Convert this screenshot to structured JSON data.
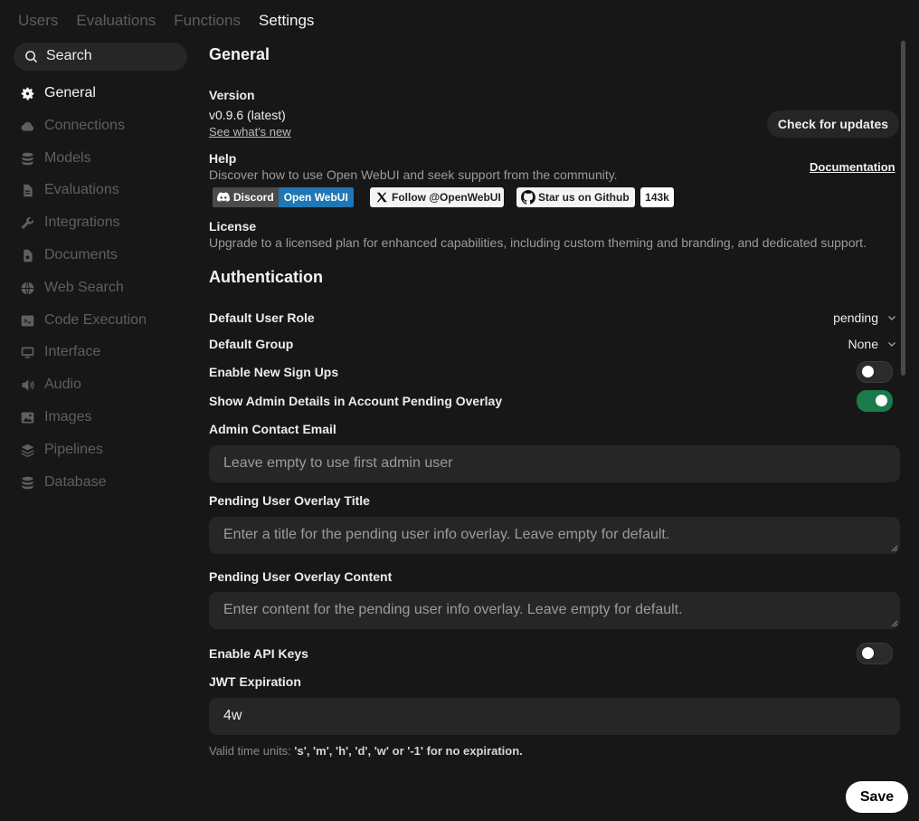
{
  "nav": {
    "tabs": [
      "Users",
      "Evaluations",
      "Functions",
      "Settings"
    ]
  },
  "sidebar": {
    "search_label": "Search",
    "items": [
      {
        "label": "General",
        "icon": "gear-icon"
      },
      {
        "label": "Connections",
        "icon": "cloud-icon"
      },
      {
        "label": "Models",
        "icon": "cube-icon"
      },
      {
        "label": "Evaluations",
        "icon": "document-icon"
      },
      {
        "label": "Integrations",
        "icon": "wrench-icon"
      },
      {
        "label": "Documents",
        "icon": "file-icon"
      },
      {
        "label": "Web Search",
        "icon": "globe-icon"
      },
      {
        "label": "Code Execution",
        "icon": "terminal-icon"
      },
      {
        "label": "Interface",
        "icon": "monitor-icon"
      },
      {
        "label": "Audio",
        "icon": "speaker-icon"
      },
      {
        "label": "Images",
        "icon": "image-icon"
      },
      {
        "label": "Pipelines",
        "icon": "stack-icon"
      },
      {
        "label": "Database",
        "icon": "database-icon"
      }
    ]
  },
  "general": {
    "title": "General",
    "version_label": "Version",
    "version_value": "v0.9.6 (latest)",
    "whats_new": "See what's new",
    "check_updates": "Check for updates",
    "help_label": "Help",
    "help_text": "Discover how to use Open WebUI and seek support from the community.",
    "documentation": "Documentation",
    "badge_discord_a": "Discord",
    "badge_discord_b": "Open WebUI",
    "badge_x": "Follow @OpenWebUI",
    "badge_github": "Star us on Github",
    "badge_github_count": "143k",
    "license_label": "License",
    "license_text": "Upgrade to a licensed plan for enhanced capabilities, including custom theming and branding, and dedicated support."
  },
  "auth": {
    "title": "Authentication",
    "default_role_label": "Default User Role",
    "default_role_value": "pending",
    "default_group_label": "Default Group",
    "default_group_value": "None",
    "signups_label": "Enable New Sign Ups",
    "signups_enabled": false,
    "admin_details_label": "Show Admin Details in Account Pending Overlay",
    "admin_details_enabled": true,
    "admin_email_label": "Admin Contact Email",
    "admin_email_placeholder": "Leave empty to use first admin user",
    "overlay_title_label": "Pending User Overlay Title",
    "overlay_title_placeholder": "Enter a title for the pending user info overlay. Leave empty for default.",
    "overlay_content_label": "Pending User Overlay Content",
    "overlay_content_placeholder": "Enter content for the pending user info overlay. Leave empty for default.",
    "api_keys_label": "Enable API Keys",
    "api_keys_enabled": false,
    "jwt_label": "JWT Expiration",
    "jwt_value": "4w",
    "jwt_hint_prefix": "Valid time units: ",
    "jwt_hint_units": "'s', 'm', 'h', 'd', 'w' or '-1' for no expiration."
  },
  "save_label": "Save",
  "colors": {
    "toggle_on": "#1a7a4a",
    "badge_blue": "#1f77b4",
    "background": "#171717"
  }
}
